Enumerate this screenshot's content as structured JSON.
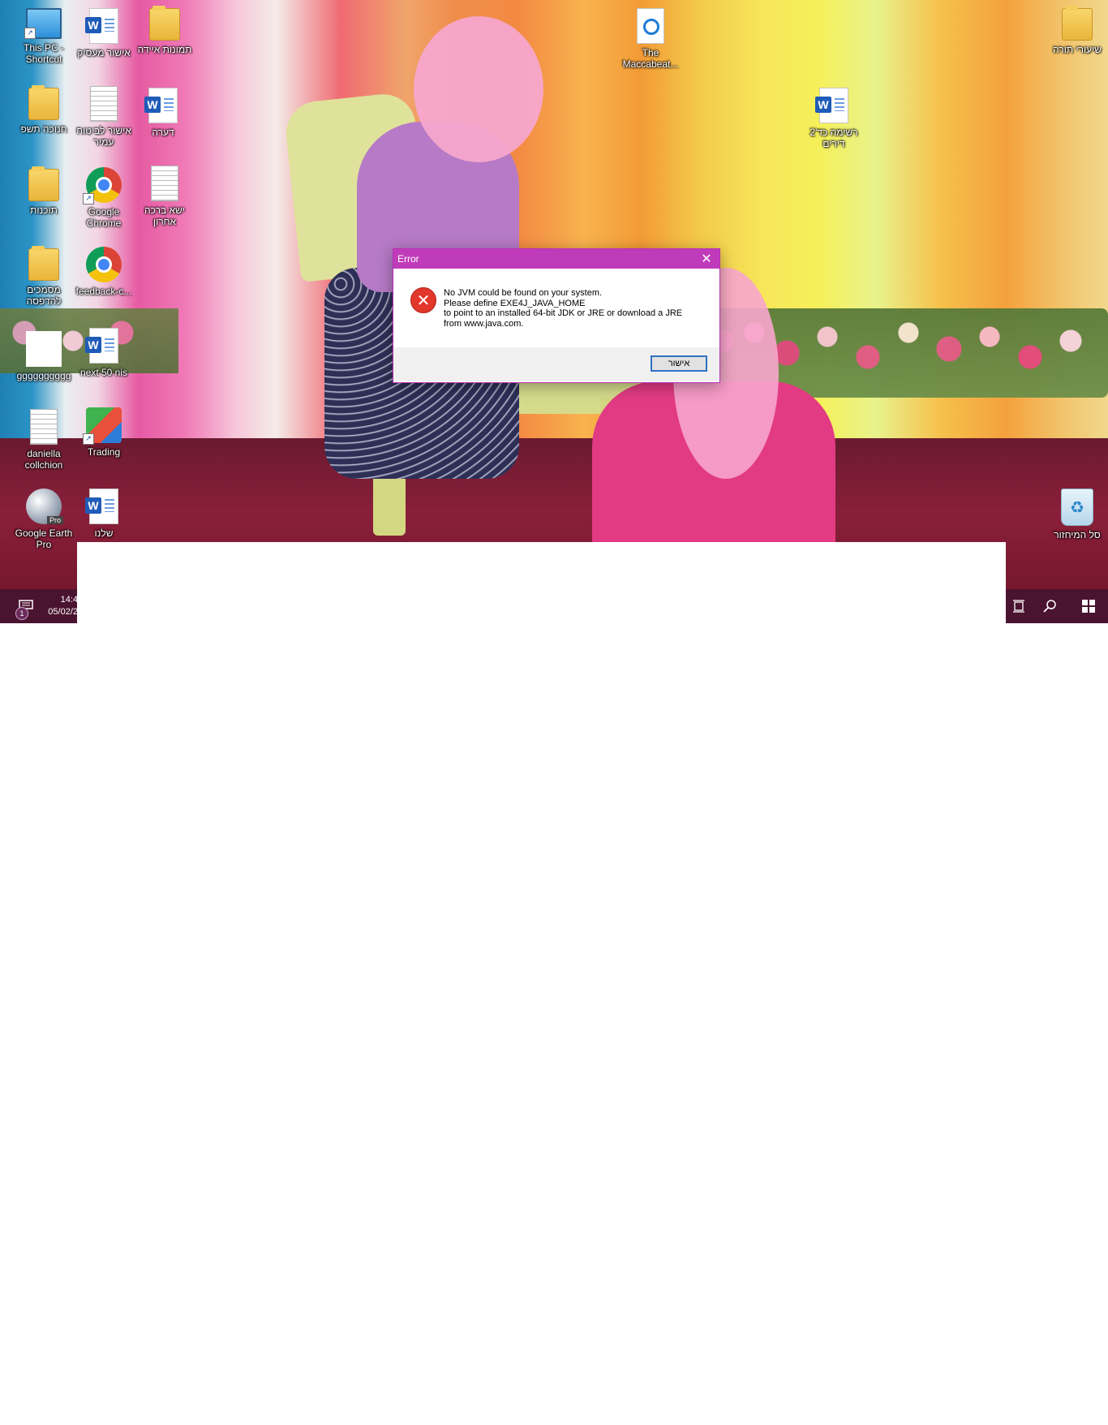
{
  "desktop": {
    "icons": [
      {
        "label": "This PC - Shortcut",
        "type": "pc-icon"
      },
      {
        "label": "אישור מעסיק",
        "type": "word-icon"
      },
      {
        "label": "תמונות איידה",
        "type": "folder-icon"
      },
      {
        "label": "חנוכה תשפ",
        "type": "folder-icon"
      },
      {
        "label": "אישור לביטוח עמיר",
        "type": "document-icon"
      },
      {
        "label": "דערה",
        "type": "word-icon"
      },
      {
        "label": "תוכנות",
        "type": "folder-icon"
      },
      {
        "label": "Google Chrome",
        "type": "chrome-icon"
      },
      {
        "label": "ישא ברכה אחרון",
        "type": "document-icon"
      },
      {
        "label": "מסמכים להדפסה",
        "type": "folder-icon"
      },
      {
        "label": "feedback-c...",
        "type": "chrome-icon"
      },
      {
        "label": "gggggggggg",
        "type": "image-icon"
      },
      {
        "label": "next 50 nis",
        "type": "word-icon"
      },
      {
        "label": "daniella collchion",
        "type": "text-file-icon"
      },
      {
        "label": "Trading",
        "type": "trading-app-icon"
      },
      {
        "label": "Google Earth Pro",
        "type": "google-earth-icon",
        "badge": "Pro"
      },
      {
        "label": "שלנו",
        "type": "word-icon"
      },
      {
        "label": "The Maccabeat...",
        "type": "media-file-icon"
      },
      {
        "label": "רשימה כד'2 דירים",
        "type": "word-icon"
      },
      {
        "label": "שיעורי תורה",
        "type": "folder-icon"
      },
      {
        "label": "סל המיחזור",
        "type": "recycle-bin-icon"
      }
    ]
  },
  "dialog": {
    "title": "Error",
    "message_lines": [
      "No JVM could be found on your system.",
      "Please define EXE4J_JAVA_HOME",
      "to point to an installed 64-bit JDK or JRE or download a JRE",
      "from www.java.com."
    ],
    "ok_label": "אישור",
    "close_glyph": "✕",
    "error_glyph": "✕"
  },
  "taskbar": {
    "time": "14:4",
    "date": "05/02/2",
    "notification_count": "1",
    "color": "#4a1330"
  },
  "colors": {
    "dialog_title": "#c03bba",
    "error_icon": "#e2372b",
    "button_border": "#2f72c4"
  }
}
